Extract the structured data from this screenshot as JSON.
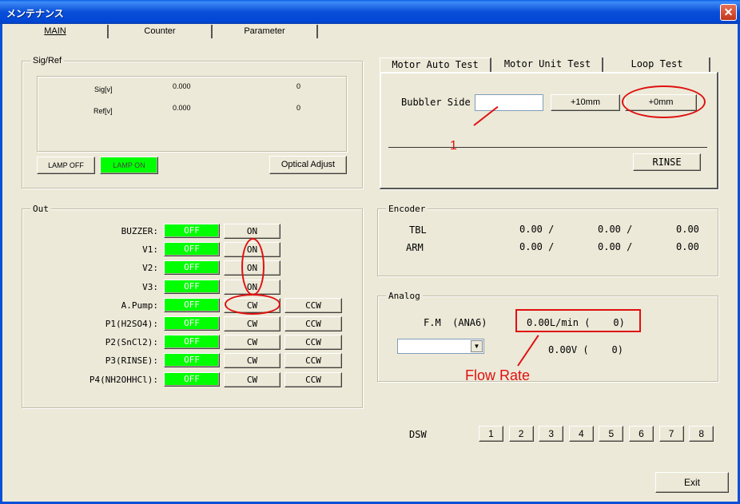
{
  "window": {
    "title": "メンテナンス",
    "close": "✕"
  },
  "tabs": [
    "MAIN",
    "Counter",
    "Parameter"
  ],
  "sigref": {
    "legend": "Sig/Ref",
    "rows": [
      {
        "label": "Sig[v]",
        "value": "0.000",
        "count": "0"
      },
      {
        "label": "Ref[v]",
        "value": "0.000",
        "count": "0"
      }
    ],
    "lamp_off": "LAMP OFF",
    "lamp_on": "LAMP ON",
    "optical_adjust": "Optical Adjust"
  },
  "out": {
    "legend": "Out",
    "rows": [
      {
        "label": "BUZZER:",
        "state": "OFF",
        "b1": "ON",
        "b2": ""
      },
      {
        "label": "V1:",
        "state": "OFF",
        "b1": "ON",
        "b2": ""
      },
      {
        "label": "V2:",
        "state": "OFF",
        "b1": "ON",
        "b2": ""
      },
      {
        "label": "V3:",
        "state": "OFF",
        "b1": "ON",
        "b2": ""
      },
      {
        "label": "A.Pump:",
        "state": "OFF",
        "b1": "CW",
        "b2": "CCW"
      },
      {
        "label": "P1(H2SO4):",
        "state": "OFF",
        "b1": "CW",
        "b2": "CCW"
      },
      {
        "label": "P2(SnCl2):",
        "state": "OFF",
        "b1": "CW",
        "b2": "CCW"
      },
      {
        "label": "P3(RINSE):",
        "state": "OFF",
        "b1": "CW",
        "b2": "CCW"
      },
      {
        "label": "P4(NH2OHHCl):",
        "state": "OFF",
        "b1": "CW",
        "b2": "CCW"
      }
    ]
  },
  "motor": {
    "tabs": [
      "Motor Auto Test",
      "Motor Unit Test",
      "Loop Test"
    ],
    "bubbler_label": "Bubbler Side",
    "bubbler_value": "",
    "plus10": "+10mm",
    "plus0": "+0mm",
    "rinse": "RINSE",
    "annotation": "1"
  },
  "encoder": {
    "legend": "Encoder",
    "rows": [
      {
        "label": "TBL",
        "v1": "0.00 /",
        "v2": "0.00 /",
        "v3": "0.00"
      },
      {
        "label": "ARM",
        "v1": "0.00 /",
        "v2": "0.00 /",
        "v3": "0.00"
      }
    ]
  },
  "analog": {
    "legend": "Analog",
    "fm_label": "F.M  (ANA6)",
    "flow": "0.00L/min (    0)",
    "volt": "0.00V (    0)",
    "select_value": "",
    "annotation": "Flow Rate"
  },
  "dsw": {
    "label": "DSW",
    "buttons": [
      "1",
      "2",
      "3",
      "4",
      "5",
      "6",
      "7",
      "8"
    ]
  },
  "exit": "Exit",
  "colors": {
    "on_green": "#00ff00",
    "annotation_red": "#e01010",
    "titlebar": "#0046d5"
  }
}
